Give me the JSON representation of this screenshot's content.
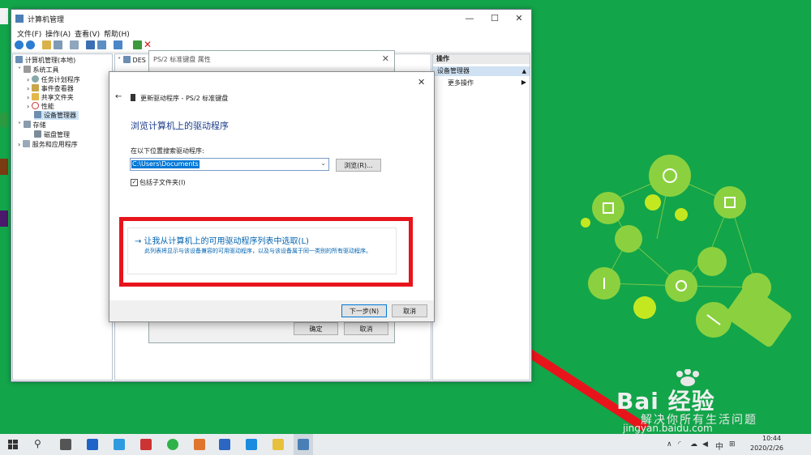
{
  "main_window": {
    "title": "计算机管理",
    "menu": [
      "文件(F)",
      "操作(A)",
      "查看(V)",
      "帮助(H)"
    ]
  },
  "tree": {
    "root": "计算机管理(本地)",
    "system_tools": "系统工具",
    "task_scheduler": "任务计划程序",
    "event_viewer": "事件查看器",
    "shared_folders": "共享文件夹",
    "performance": "性能",
    "device_manager": "设备管理器",
    "storage": "存储",
    "disk_management": "磁盘管理",
    "services": "服务和应用程序"
  },
  "middle": {
    "header": "DES"
  },
  "actions": {
    "title": "操作",
    "selected": "设备管理器",
    "more": "更多操作"
  },
  "props_dialog": {
    "title": "PS/2 标准键盘 属性",
    "ok": "确定",
    "cancel": "取消"
  },
  "wizard": {
    "title": "更新驱动程序 - PS/2 标准键盘",
    "heading": "浏览计算机上的驱动程序",
    "search_label": "在以下位置搜索驱动程序:",
    "path_value": "C:\\Users\\Documents",
    "browse": "浏览(R)...",
    "include_sub": "包括子文件夹(I)",
    "pick_link": "→ 让我从计算机上的可用驱动程序列表中选取(L)",
    "pick_desc": "此列表将显示与该设备兼容的可用驱动程序，以及与该设备属于同一类别的所有驱动程序。",
    "next": "下一步(N)",
    "cancel": "取消"
  },
  "watermark": {
    "brand": "Bai 经验",
    "slogan": "解决你所有生活问题",
    "url": "jingyan.baidu.com"
  },
  "taskbar": {
    "ime": "中",
    "time": "10:44",
    "date": "2020/2/26"
  },
  "colors": {
    "desktop": "#13a54a",
    "highlight": "#e8141c",
    "link": "#0063b1",
    "arrow": "#e8141c"
  }
}
